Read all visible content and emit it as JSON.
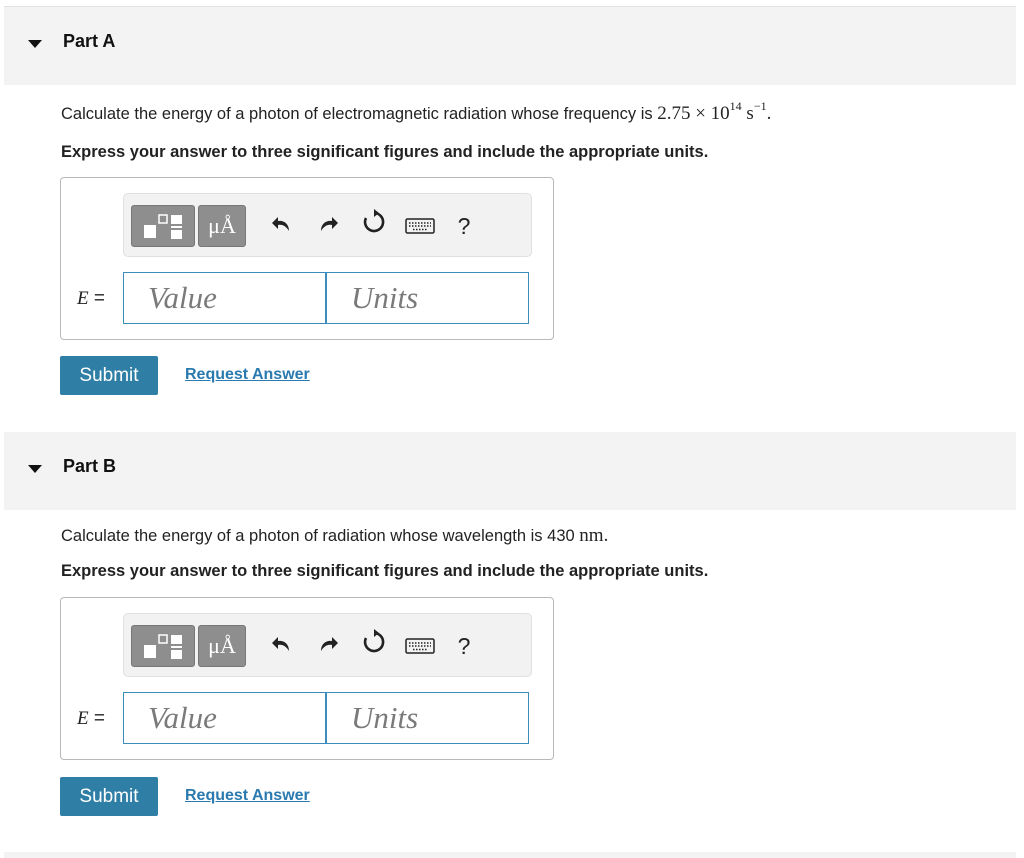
{
  "parts": [
    {
      "title": "Part A",
      "question_prefix": "Calculate the energy of a photon of electromagnetic radiation whose frequency is",
      "question_mantissa": "2.75",
      "question_times": "×",
      "question_base": "10",
      "question_exp": "14",
      "question_unit": "s",
      "question_unit_exp": "−1",
      "question_suffix": ".",
      "instruction": "Express your answer to three significant figures and include the appropriate units.",
      "variable": "E",
      "equals": "=",
      "value_placeholder": "Value",
      "units_placeholder": "Units",
      "submit_label": "Submit",
      "request_label": "Request Answer"
    },
    {
      "title": "Part B",
      "question_prefix": "Calculate the energy of a photon of radiation whose wavelength is 430",
      "question_unit": "nm",
      "question_suffix": ".",
      "instruction": "Express your answer to three significant figures and include the appropriate units.",
      "variable": "E",
      "equals": "=",
      "value_placeholder": "Value",
      "units_placeholder": "Units",
      "submit_label": "Submit",
      "request_label": "Request Answer"
    }
  ],
  "toolbar": {
    "units_button_label": "μÅ",
    "help_label": "?",
    "icons": [
      "templates-icon",
      "units-icon",
      "undo-icon",
      "redo-icon",
      "reset-icon",
      "keyboard-icon",
      "help-icon"
    ]
  },
  "colors": {
    "header_bg": "#f3f3f3",
    "submit_bg": "#2f7ea5",
    "link": "#2a7ab0",
    "input_border": "#3c8dbc",
    "toolbar_button": "#8e8e8e"
  }
}
